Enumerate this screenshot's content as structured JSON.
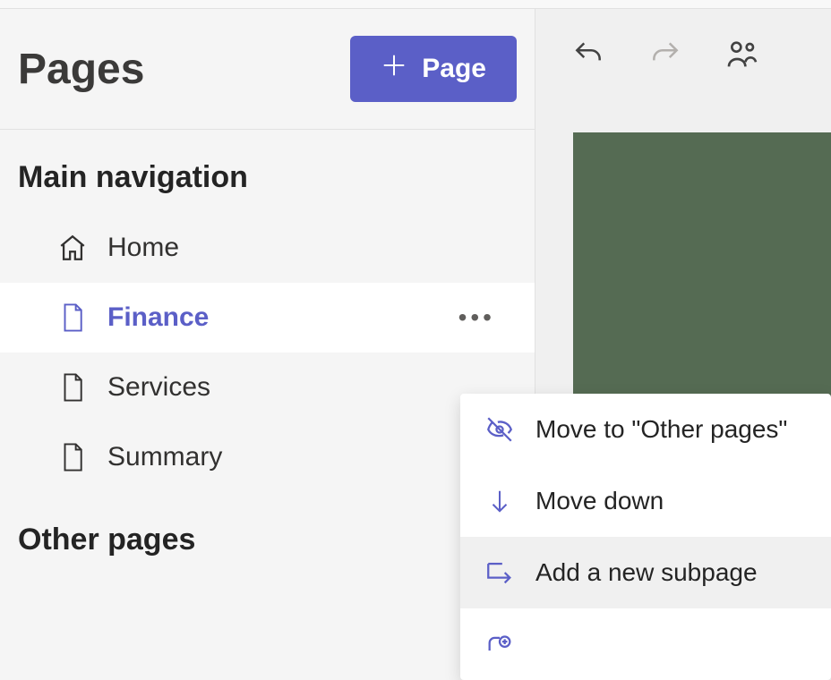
{
  "sidebar": {
    "title": "Pages",
    "new_page_label": "Page",
    "sections": {
      "main_nav": {
        "heading": "Main navigation",
        "items": [
          {
            "label": "Home",
            "icon": "home-icon",
            "selected": false
          },
          {
            "label": "Finance",
            "icon": "page-icon",
            "selected": true
          },
          {
            "label": "Services",
            "icon": "page-icon",
            "selected": false
          },
          {
            "label": "Summary",
            "icon": "page-icon",
            "selected": false
          }
        ]
      },
      "other_pages": {
        "heading": "Other pages"
      }
    }
  },
  "toolbar": {
    "undo": "undo",
    "redo": "redo",
    "comments": "comments"
  },
  "context_menu": {
    "items": [
      {
        "label": "Move to \"Other pages\"",
        "icon": "hide-icon"
      },
      {
        "label": "Move down",
        "icon": "arrow-down-icon"
      },
      {
        "label": "Add a new subpage",
        "icon": "subpage-icon",
        "hovered": true
      }
    ]
  },
  "colors": {
    "accent": "#5b5fc7",
    "canvas": "#556b53"
  }
}
